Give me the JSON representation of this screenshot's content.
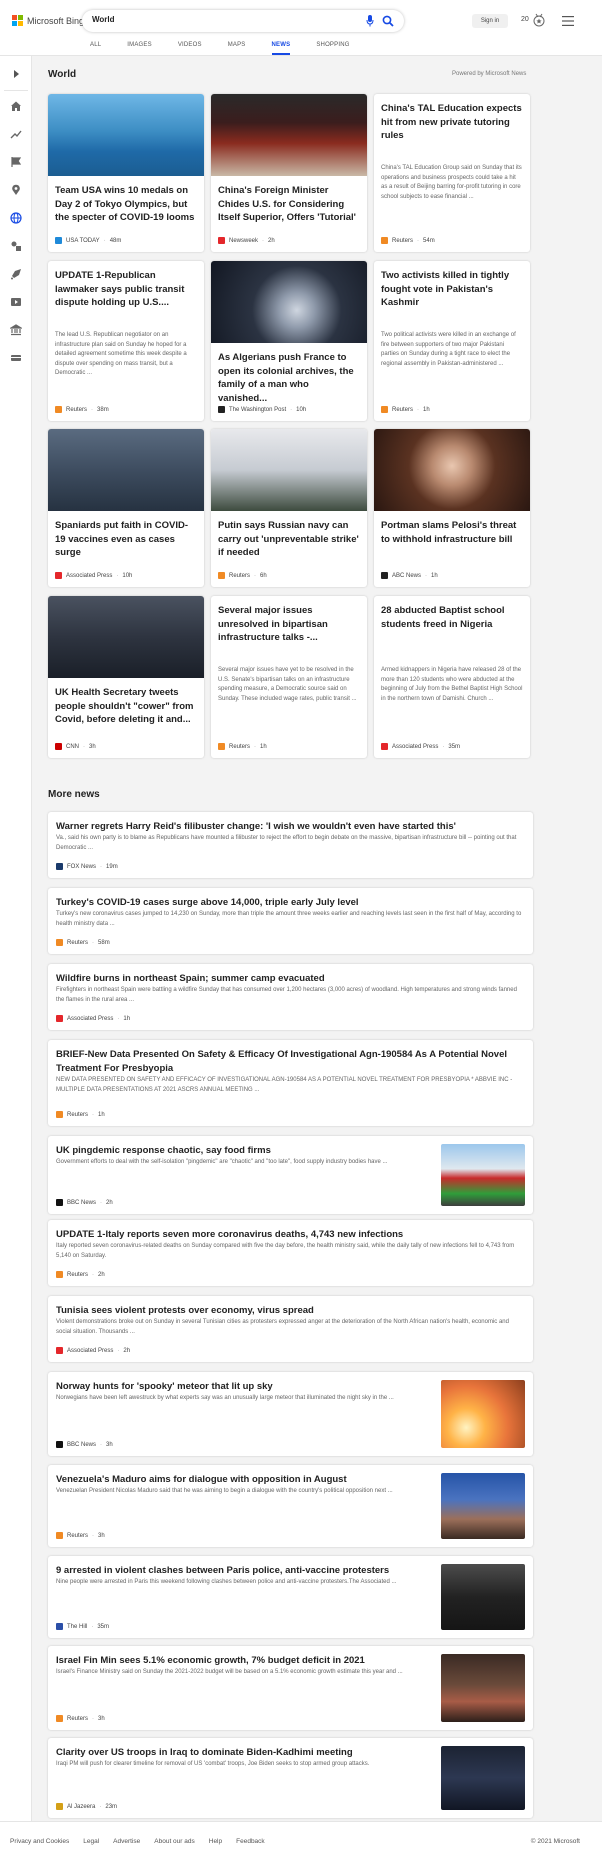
{
  "app": {
    "logo_text": "Microsoft Bing"
  },
  "search": {
    "query": "World"
  },
  "header": {
    "signin_label": "Sign in",
    "rewards_count": "20"
  },
  "tabs": [
    {
      "label": "ALL"
    },
    {
      "label": "IMAGES"
    },
    {
      "label": "VIDEOS"
    },
    {
      "label": "MAPS"
    },
    {
      "label": "NEWS",
      "active": true
    },
    {
      "label": "SHOPPING"
    }
  ],
  "world": {
    "title": "World",
    "powered_by": "Powered by Microsoft News",
    "cards": [
      {
        "title": "Team USA wins 10 medals on Day 2 of Tokyo Olympics, but the specter of COVID-19 looms",
        "snippet": "",
        "source": "USA TODAY",
        "time": "48m",
        "source_color": "#1f8ad9",
        "image": "swimmer"
      },
      {
        "title": "China's Foreign Minister Chides U.S. for Considering Itself Superior, Offers 'Tutorial'",
        "snippet": "",
        "source": "Newsweek",
        "time": "2h",
        "source_color": "#e4272b",
        "image": "meeting"
      },
      {
        "title": "China's TAL Education expects hit from new private tutoring rules",
        "snippet": "China's TAL Education Group said on Sunday that its operations and business prospects could take a hit as a result of Beijing barring for-profit tutoring in core school subjects to ease financial ...",
        "source": "Reuters",
        "time": "54m",
        "source_color": "#f08a24",
        "image": ""
      },
      {
        "title": "UPDATE 1-Republican lawmaker says public transit dispute holding up U.S....",
        "snippet": "The lead U.S. Republican negotiator on an infrastructure plan said on Sunday he hoped for a detailed agreement sometime this week despite a dispute over spending on mass transit, but a Democratic ...",
        "source": "Reuters",
        "time": "38m",
        "source_color": "#f08a24",
        "image": ""
      },
      {
        "title": "As Algerians push France to open its colonial archives, the family of a man who vanished...",
        "snippet": "",
        "source": "The Washington Post",
        "time": "10h",
        "source_color": "#222222",
        "image": "statue"
      },
      {
        "title": "Two activists killed in tightly fought vote in Pakistan's Kashmir",
        "snippet": "Two political activists were killed in an exchange of fire between supporters of two major Pakistani parties on Sunday during a tight race to elect the regional assembly in Pakistan-administered ...",
        "source": "Reuters",
        "time": "1h",
        "source_color": "#f08a24",
        "image": ""
      },
      {
        "title": "Spaniards put faith in COVID-19 vaccines even as cases surge",
        "snippet": "",
        "source": "Associated Press",
        "time": "10h",
        "source_color": "#e4272b",
        "image": "crowd"
      },
      {
        "title": "Putin says Russian navy can carry out 'unpreventable strike' if needed",
        "snippet": "",
        "source": "Reuters",
        "time": "6h",
        "source_color": "#f08a24",
        "image": "navy"
      },
      {
        "title": "Portman slams Pelosi's threat to withhold infrastructure bill",
        "snippet": "",
        "source": "ABC News",
        "time": "1h",
        "source_color": "#222222",
        "image": "senator"
      },
      {
        "title": "UK Health Secretary tweets people shouldn't \"cower\" from Covid, before deleting it and...",
        "snippet": "",
        "source": "CNN",
        "time": "3h",
        "source_color": "#cc0000",
        "image": "secretary"
      },
      {
        "title": "Several major issues unresolved in bipartisan infrastructure talks -...",
        "snippet": "Several major issues have yet to be resolved in the U.S. Senate's bipartisan talks on an infrastructure spending measure, a Democratic source said on Sunday. These included wage rates, public transit ...",
        "source": "Reuters",
        "time": "1h",
        "source_color": "#f08a24",
        "image": ""
      },
      {
        "title": "28 abducted Baptist school students freed in Nigeria",
        "snippet": "Armed kidnappers in Nigeria have released 28 of the more than 120 students who were abducted at the beginning of July from the Bethel Baptist High School in the northern town of Damishi. Church ...",
        "source": "Associated Press",
        "time": "35m",
        "source_color": "#e4272b",
        "image": ""
      }
    ]
  },
  "more_news": {
    "title": "More news",
    "items": [
      {
        "title": "Warner regrets Harry Reid's filibuster change: 'I wish we wouldn't even have started this'",
        "snippet": "Va., said his own party is to blame as Republicans have mounted a filibuster to reject the effort to begin debate on the massive, bipartisan infrastructure bill -- pointing out that Democratic ...",
        "source": "FOX News",
        "time": "19m",
        "source_color": "#1a3a6b",
        "image": ""
      },
      {
        "title": "Turkey's COVID-19 cases surge above 14,000, triple early July level",
        "snippet": "Turkey's new coronavirus cases jumped to 14,230 on Sunday, more than triple the amount three weeks earlier and reaching levels last seen in the first half of May, according to health ministry data ...",
        "source": "Reuters",
        "time": "58m",
        "source_color": "#f08a24",
        "image": ""
      },
      {
        "title": "Wildfire burns in northeast Spain; summer camp evacuated",
        "snippet": "Firefighters in northeast Spain were battling a wildfire Sunday that has consumed over 1,200 hectares (3,000 acres) of woodland. High temperatures and strong winds fanned the flames in the rural area ...",
        "source": "Associated Press",
        "time": "1h",
        "source_color": "#e4272b",
        "image": ""
      },
      {
        "title": "BRIEF-New Data Presented On Safety & Efficacy Of Investigational Agn-190584 As A Potential Novel Treatment For Presbyopia",
        "snippet": "NEW DATA PRESENTED ON SAFETY AND EFFICACY OF INVESTIGATIONAL AGN-190584 AS A POTENTIAL NOVEL TREATMENT FOR PRESBYOPIA * ABBVIE INC - MULTIPLE DATA PRESENTATIONS AT 2021 ASCRS ANNUAL MEETING ...",
        "source": "Reuters",
        "time": "1h",
        "source_color": "#f08a24",
        "image": ""
      },
      {
        "title": "UK pingdemic response chaotic, say food firms",
        "snippet": "Government efforts to deal with the self-isolation \"pingdemic\" are \"chaotic\" and \"too late\", food supply industry bodies have ...",
        "source": "BBC News",
        "time": "2h",
        "source_color": "#111111",
        "image": "trucks"
      },
      {
        "title": "UPDATE 1-Italy reports seven more coronavirus deaths, 4,743 new infections",
        "snippet": "Italy reported seven coronavirus-related deaths on Sunday compared with five the day before, the health ministry said, while the daily tally of new infections fell to 4,743 from 5,140 on Saturday.",
        "source": "Reuters",
        "time": "2h",
        "source_color": "#f08a24",
        "image": ""
      },
      {
        "title": "Tunisia sees violent protests over economy, virus spread",
        "snippet": "Violent demonstrations broke out on Sunday in several Tunisian cities as protesters expressed anger at the deterioration of the North African nation's health, economic and social situation. Thousands ...",
        "source": "Associated Press",
        "time": "2h",
        "source_color": "#e4272b",
        "image": ""
      },
      {
        "title": "Norway hunts for 'spooky' meteor that lit up sky",
        "snippet": "Norwegians have been left awestruck by what experts say was an unusually large meteor that illuminated the night sky in the ...",
        "source": "BBC News",
        "time": "3h",
        "source_color": "#111111",
        "image": "meteor"
      },
      {
        "title": "Venezuela's Maduro aims for dialogue with opposition in August",
        "snippet": "Venezuelan President Nicolas Maduro said that he was aiming to begin a dialogue with the country's political opposition next ...",
        "source": "Reuters",
        "time": "3h",
        "source_color": "#f08a24",
        "image": "maduro"
      },
      {
        "title": "9 arrested in violent clashes between Paris police, anti-vaccine protesters",
        "snippet": "Nine people were arrested in Paris this weekend following clashes between police and anti-vaccine protesters.The Associated ...",
        "source": "The Hill",
        "time": "35m",
        "source_color": "#2b4fa8",
        "image": "police"
      },
      {
        "title": "Israel Fin Min sees 5.1% economic growth, 7% budget deficit in 2021",
        "snippet": "Israel's Finance Ministry said on Sunday the 2021-2022 budget will be based on a 5.1% economic growth estimate this year and ...",
        "source": "Reuters",
        "time": "3h",
        "source_color": "#f08a24",
        "image": "knesset"
      },
      {
        "title": "Clarity over US troops in Iraq to dominate Biden-Kadhimi meeting",
        "snippet": "Iraqi PM will push for clearer timeline for removal of US 'combat' troops, Joe Biden seeks to stop armed group attacks.",
        "source": "Al Jazeera",
        "time": "23m",
        "source_color": "#d4a017",
        "image": "kadhimi"
      }
    ]
  },
  "footer": {
    "links": [
      "Privacy and Cookies",
      "Legal",
      "Advertise",
      "About our ads",
      "Help",
      "Feedback"
    ],
    "copyright": "© 2021 Microsoft"
  },
  "colors": {
    "accent": "#174ae4",
    "page_bg": "#f3f3f3"
  }
}
